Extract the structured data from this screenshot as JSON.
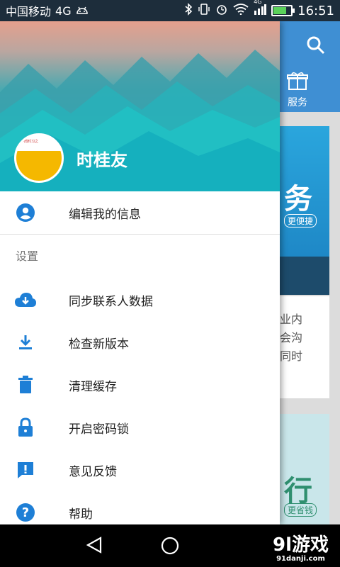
{
  "status_bar": {
    "carrier": "中国移动",
    "network": "4G",
    "network_small": "4G",
    "time": "16:51"
  },
  "drawer": {
    "user_name": "时桂友",
    "avatar_text": "学而时习之",
    "edit_profile_label": "编辑我的信息",
    "settings_section": "设置",
    "items": [
      {
        "label": "同步联系人数据",
        "icon": "cloud-download-icon"
      },
      {
        "label": "检查新版本",
        "icon": "download-icon"
      },
      {
        "label": "清理缓存",
        "icon": "trash-icon"
      },
      {
        "label": "开启密码锁",
        "icon": "lock-icon"
      },
      {
        "label": "意见反馈",
        "icon": "feedback-icon"
      },
      {
        "label": "帮助",
        "icon": "help-icon"
      }
    ]
  },
  "background_app": {
    "service_tab_label": "服务",
    "card1_text": "务",
    "card1_sub": "更便捷",
    "card2_text": [
      "业内",
      "会沟",
      "同时"
    ],
    "card3_text": "行",
    "card3_sub": "更省钱"
  },
  "watermark": {
    "brand": "9l游戏",
    "url": "91danji.com"
  },
  "colors": {
    "accent": "#1e7fd6",
    "status_bar": "#1d2d3b",
    "header_teal": "#20bcc4"
  }
}
